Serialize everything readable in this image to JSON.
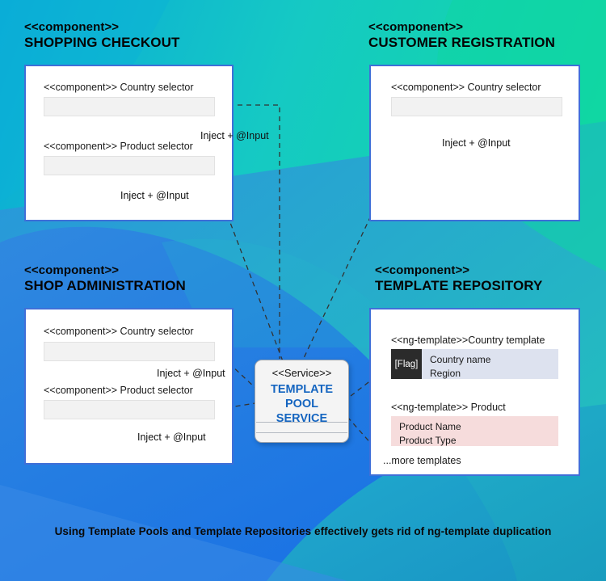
{
  "background": {
    "colors": {
      "top_left_cyan": "#0eaed4",
      "top_right_mint": "#12dba0",
      "mid_teal": "#2bc9c0",
      "mid_blue": "#2b93dd",
      "bottom_blue": "#1a6fe0",
      "bottom_right_teal": "#19a7c4"
    }
  },
  "accent": {
    "panel_border": "#3f6fd8",
    "service_text": "#1565c0",
    "field_fill": "#f2f2f2",
    "country_row_fill": "#dde2ef",
    "product_row_fill": "#f6dcdc",
    "flag_fill": "#2b2b2b",
    "connector": "#333333"
  },
  "groups": [
    {
      "id": "shopping-checkout",
      "stereotype": "<<component>>",
      "name": "SHOPPING CHECKOUT",
      "fields": [
        {
          "label": "<<component>> Country selector"
        },
        {
          "label": "<<component>> Product selector"
        }
      ],
      "inject_labels": [
        "Inject + @Input",
        "Inject + @Input"
      ]
    },
    {
      "id": "customer-registration",
      "stereotype": "<<component>>",
      "name": "CUSTOMER REGISTRATION",
      "fields": [
        {
          "label": "<<component>> Country selector"
        }
      ],
      "inject_labels": [
        "Inject + @Input"
      ]
    },
    {
      "id": "shop-administration",
      "stereotype": "<<component>>",
      "name": "SHOP ADMINISTRATION",
      "fields": [
        {
          "label": "<<component>> Country selector"
        },
        {
          "label": "<<component>> Product selector"
        }
      ],
      "inject_labels": [
        "Inject + @Input",
        "Inject + @Input"
      ]
    },
    {
      "id": "template-repository",
      "stereotype": "<<component>>",
      "name": "TEMPLATE REPOSITORY",
      "templates": [
        {
          "label": "<<ng-template>>Country template",
          "flag": "[Flag]",
          "lines": [
            "Country name",
            "Region"
          ]
        },
        {
          "label": "<<ng-template>> Product",
          "lines": [
            "Product Name",
            "Product Type"
          ]
        }
      ],
      "more": "...more templates"
    }
  ],
  "service": {
    "stereotype": "<<Service>>",
    "name": "TEMPLATE\nPOOL\nSERVICE"
  },
  "caption": "Using Template Pools and Template Repositories effectively gets rid of ng-template duplication"
}
